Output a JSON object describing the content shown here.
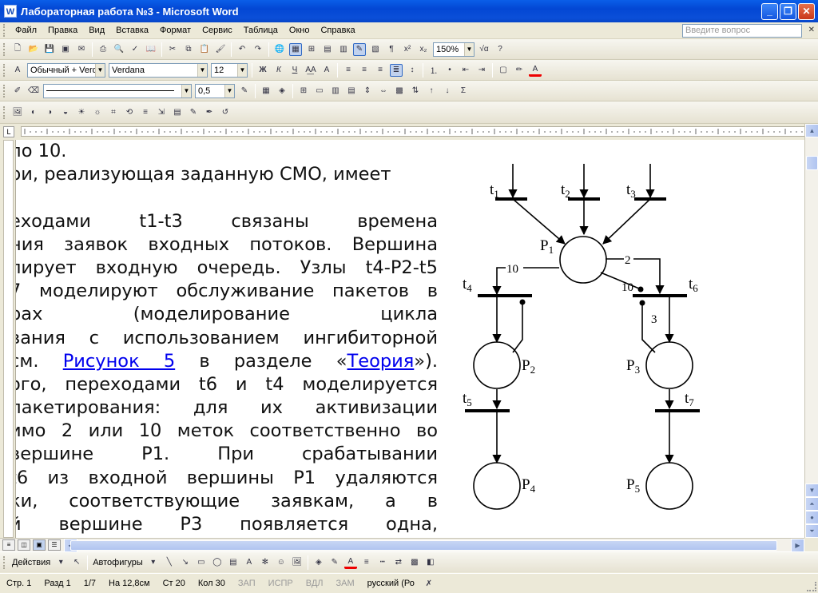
{
  "window": {
    "app_icon": "W",
    "title": "Лабораторная работа №3 - Microsoft Word",
    "buttons": [
      "minimize",
      "restore",
      "close"
    ]
  },
  "menu": {
    "items": [
      "Файл",
      "Правка",
      "Вид",
      "Вставка",
      "Формат",
      "Сервис",
      "Таблица",
      "Окно",
      "Справка"
    ],
    "ask_placeholder": "Введите вопрос"
  },
  "standard_toolbar": {
    "zoom": "150%"
  },
  "formatting_toolbar": {
    "style": "Обычный + Verd",
    "font": "Verdana",
    "size": "12",
    "bold": "Ж",
    "italic": "К",
    "underline": "Ч"
  },
  "tables_toolbar": {
    "line_weight": "0,5"
  },
  "document": {
    "lines": [
      {
        "segments": [
          "по 10."
        ]
      },
      {
        "segments": [
          "ри, реализующая заданную СМО, имеет"
        ]
      },
      {
        "segments": [
          ""
        ]
      },
      {
        "segments": [
          "еходами    t1-t3    связаны    времена"
        ]
      },
      {
        "segments": [
          "ния заявок входных потоков. Вершина"
        ]
      },
      {
        "segments": [
          "лирует входную очередь. Узлы t4-P2-t5"
        ]
      },
      {
        "segments": [
          "7 моделируют обслуживание пакетов в"
        ]
      },
      {
        "segments": [
          "рах          (моделирование          цикла"
        ]
      },
      {
        "segments": [
          "вания с использованием ингибиторной"
        ]
      },
      {
        "segments": [
          " см. ",
          "Рисунок 5",
          " в разделе «",
          "Теория",
          "»)."
        ]
      },
      {
        "segments": [
          "ого, переходами t6 и t4 моделируется"
        ]
      },
      {
        "segments": [
          " пакетирования: для их активизации"
        ]
      },
      {
        "segments": [
          "имо 2 или 10 меток соответственно во"
        ]
      },
      {
        "segments": [
          "  вершине  P1.  При  срабатывании"
        ]
      },
      {
        "segments": [
          " t6 из входной вершины P1 удаляются"
        ]
      },
      {
        "segments": [
          "ки,  соответствующие  заявкам,  а  в"
        ]
      },
      {
        "segments": [
          "й    вершине    Р3    появляется    одна,"
        ]
      }
    ],
    "figure": {
      "transitions": [
        "t",
        "t",
        "t",
        "t",
        "t",
        "t",
        "t"
      ],
      "transition_subscripts": [
        "1",
        "2",
        "3",
        "4",
        "5",
        "6",
        "7"
      ],
      "places": [
        "P",
        "P",
        "P",
        "P",
        "P"
      ],
      "place_subscripts": [
        "1",
        "2",
        "3",
        "4",
        "5"
      ],
      "arc_weights": [
        "10",
        "2",
        "10",
        "3"
      ]
    }
  },
  "draw_toolbar": {
    "actions": "Действия",
    "autoshapes": "Автофигуры"
  },
  "status": {
    "page": "Стр. 1",
    "section": "Разд 1",
    "pages": "1/7",
    "at": "На 12,8см",
    "line": "Ст 20",
    "col": "Кол 30",
    "rec": "ЗАП",
    "trk": "ИСПР",
    "ext": "ВДЛ",
    "ovr": "ЗАМ",
    "lang": "русский (Ро"
  }
}
